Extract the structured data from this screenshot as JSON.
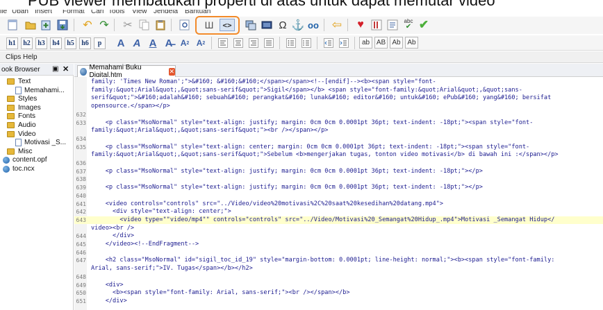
{
  "caption": "PUB viewer membatukan properti di atas untuk dapat memutar video",
  "menu": {
    "items": [
      "ile",
      "Ubah",
      "Insert",
      "Format",
      "Cari",
      "Tools",
      "View",
      "Jendela",
      "Bantuan"
    ]
  },
  "toolbar": {
    "icons": [
      "new-book-icon",
      "open-folder-icon",
      "add-file-icon",
      "save-icon",
      "undo-icon",
      "redo-icon",
      "cut-icon",
      "copy-icon",
      "paste-icon",
      "preview-icon",
      "book-view-icon",
      "code-view-icon",
      "insert-image-icon",
      "insert-media-icon",
      "omega-special-char-icon",
      "anchor-icon",
      "link-icon",
      "back-arrow-icon",
      "heart-icon",
      "meta-editor-icon",
      "toc-list-icon",
      "spellcheck-icon",
      "validate-checkmark-icon"
    ],
    "highlight_color": "#f28a2a"
  },
  "format_toolbar": {
    "heading_buttons": [
      "h1",
      "h2",
      "h3",
      "h4",
      "h5",
      "h6",
      "p"
    ],
    "case_buttons": [
      "ab",
      "AB",
      "Ab",
      "Ab"
    ]
  },
  "clips_panel": {
    "title": "Clips Help"
  },
  "book_browser": {
    "title": "ook Browser",
    "items": [
      {
        "label": "Text",
        "kind": "folder"
      },
      {
        "label": "Memahami...",
        "kind": "file"
      },
      {
        "label": "Styles",
        "kind": "folder"
      },
      {
        "label": "Images",
        "kind": "folder"
      },
      {
        "label": "Fonts",
        "kind": "folder"
      },
      {
        "label": "Audio",
        "kind": "folder"
      },
      {
        "label": "Video",
        "kind": "folder"
      },
      {
        "label": "Motivasi _S...",
        "kind": "file"
      },
      {
        "label": "Misc",
        "kind": "folder"
      },
      {
        "label": "content.opf",
        "kind": "globe"
      },
      {
        "label": "toc.ncx",
        "kind": "globe"
      }
    ]
  },
  "tab": {
    "title": "Memahami Buku Digital.htm"
  },
  "editor": {
    "line_numbers": [
      "",
      "",
      "",
      "",
      "632",
      "633",
      "",
      "634",
      "635",
      "",
      "636",
      "637",
      "638",
      "639",
      "640",
      "641",
      "642",
      "643",
      "",
      "644",
      "645",
      "646",
      "647",
      "",
      "648",
      "649",
      "650",
      "651"
    ],
    "lines": [
      "family: 'Times New Roman';\">&#160; &#160;&#160;</span></span><!--[endif]--><b><span style=\"font-",
      "family:&quot;Arial&quot;,&quot;sans-serif&quot;\">Sigil</span></b> <span style=\"font-family:&quot;Arial&quot;,&quot;sans-",
      "serif&quot;\">&#160;adalah&#160; sebuah&#160; perangkat&#160; lunak&#160; editor&#160; untuk&#160; ePub&#160; yang&#160; bersifat",
      "opensource.</span></p>",
      "",
      "    <p class=\"MsoNormal\" style=\"text-align: justify; margin: 0cm 0cm 0.0001pt 36pt; text-indent: -18pt;\"><span style=\"font-",
      "family:&quot;Arial&quot;,&quot;sans-serif&quot;\"><br /></span></p>",
      "",
      "    <p class=\"MsoNormal\" style=\"text-align: center; margin: 0cm 0cm 0.0001pt 36pt; text-indent: -18pt;\"><span style=\"font-",
      "family:&quot;Arial&quot;,&quot;sans-serif&quot;\">Sebelum <b>mengerjakan tugas, tonton video motivasi</b> di bawah ini :</span></p>",
      "",
      "    <p class=\"MsoNormal\" style=\"text-align: justify; margin: 0cm 0cm 0.0001pt 36pt; text-indent: -18pt;\"></p>",
      "",
      "    <p class=\"MsoNormal\" style=\"text-align: justify; margin: 0cm 0cm 0.0001pt 36pt; text-indent: -18pt;\"></p>",
      "",
      "    <video controls=\"controls\" src=\"../Video/video%20motivasi%2C%20saat%20kesedihan%20datang.mp4\">",
      "      <div style=\"text-align: center;\">",
      "        <video type=\"\"video/mp4\"\" controls=\"controls\" src=\"../Video/Motivasi%20_Semangat%20Hidup_.mp4\">Motivasi _Semangat Hidup</",
      "video><br />",
      "      </div>",
      "    </video><!--EndFragment-->",
      "",
      "    <h2 class=\"MsoNormal\" id=\"sigil_toc_id_19\" style=\"margin-bottom: 0.0001pt; line-height: normal;\"><b><span style=\"font-family:",
      "Arial, sans-serif;\">IV. Tugas</span></b></h2>",
      "",
      "    <div>",
      "      <b><span style=\"font-family: Arial, sans-serif;\"><br /></span></b>",
      "    </div>"
    ]
  }
}
